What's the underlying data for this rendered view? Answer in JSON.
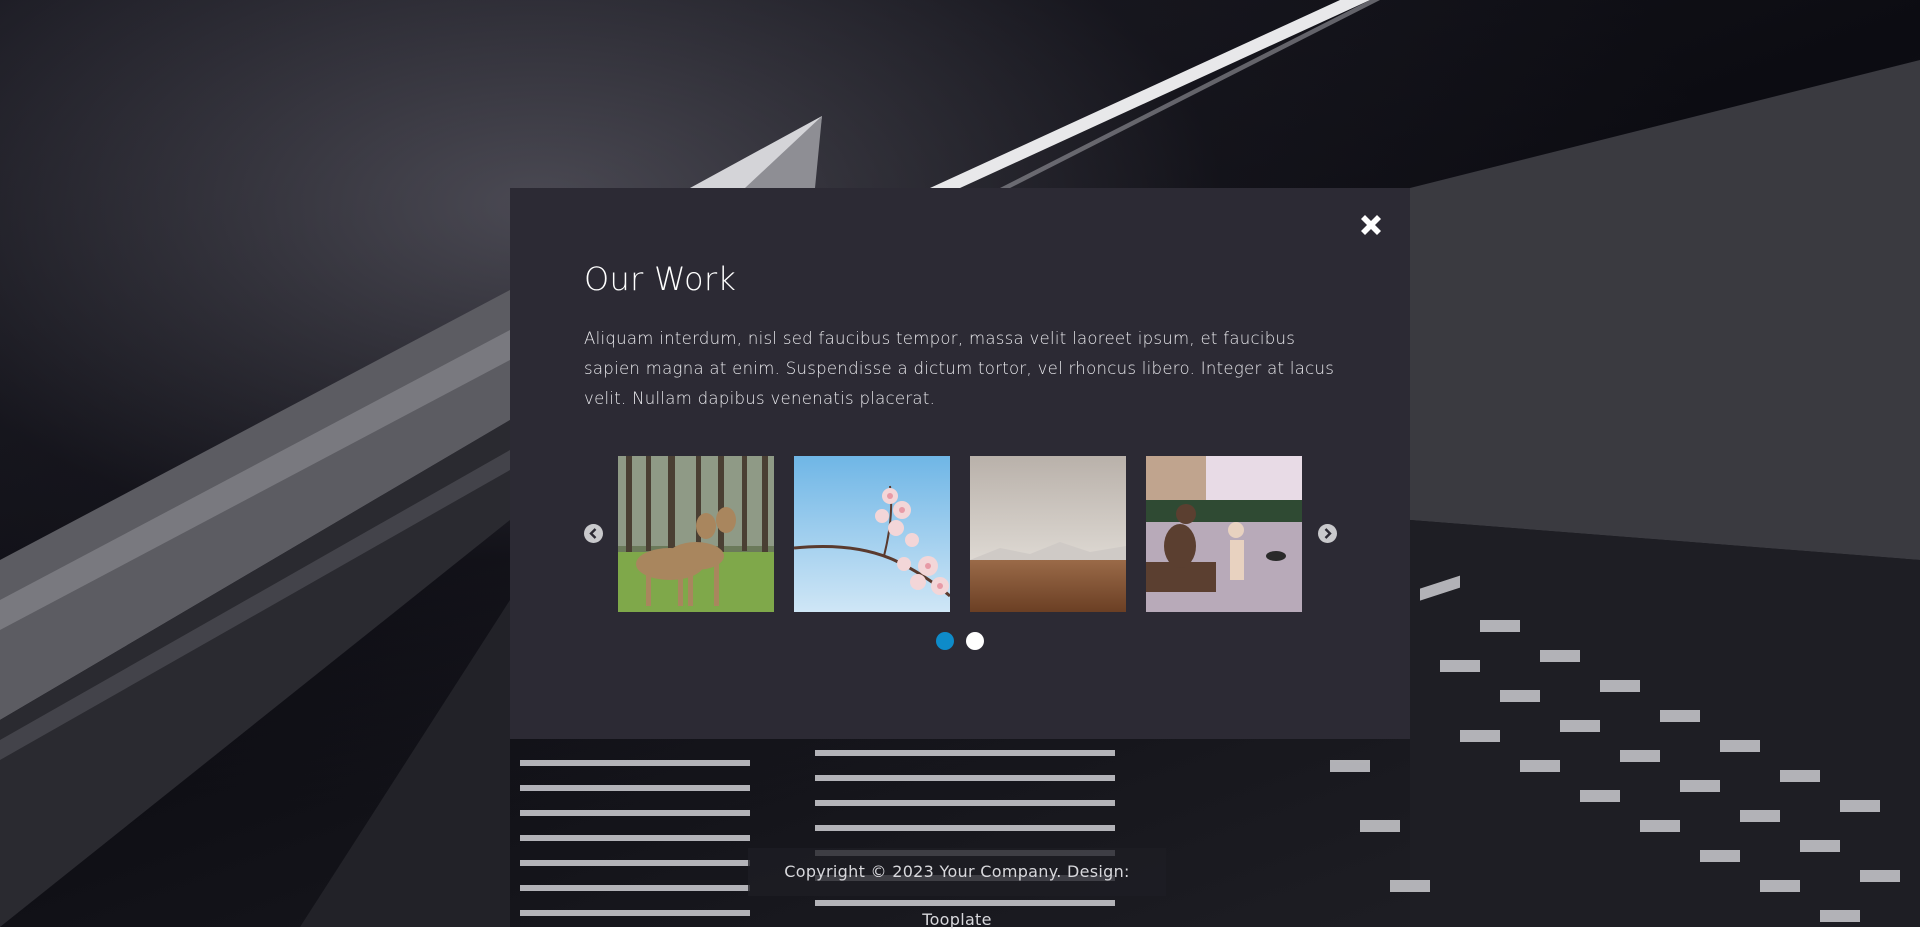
{
  "modal": {
    "title": "Our Work",
    "description": "Aliquam interdum, nisl sed faucibus tempor, massa velit laoreet ipsum, et faucibus sapien magna at enim. Suspendisse a dictum tortor, vel rhoncus libero. Integer at lacus velit. Nullam dapibus venenatis placerat.",
    "close_icon": "close-icon"
  },
  "carousel": {
    "prev_icon": "chevron-left-icon",
    "next_icon": "chevron-right-icon",
    "active_page": 1,
    "page_count": 2
  },
  "colors": {
    "accent": "#0e8bc9",
    "modal_bg": "#2c2a34"
  },
  "footer": {
    "copyright": "Copyright © 2023 Your Company. Design: Tooplate"
  }
}
